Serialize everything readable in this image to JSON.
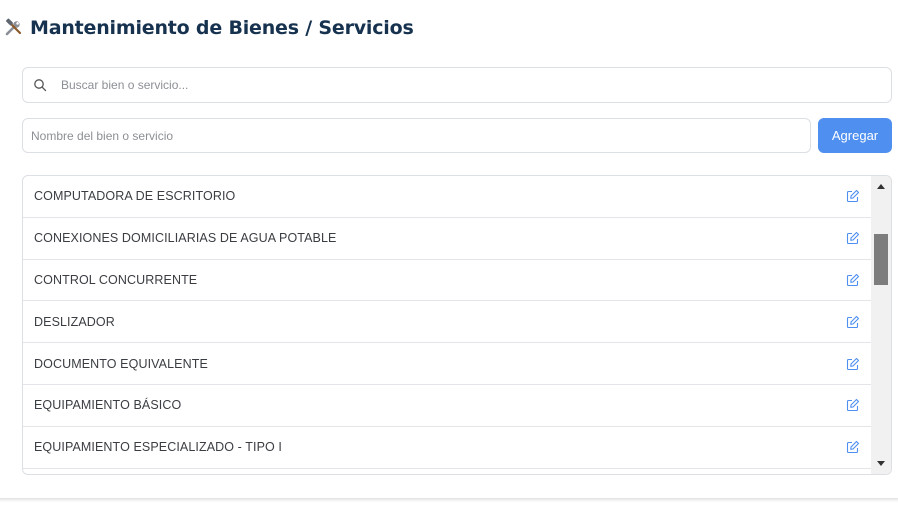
{
  "header": {
    "title": "Mantenimiento de Bienes / Servicios",
    "icon": "hammer-wrench-icon"
  },
  "search": {
    "placeholder": "Buscar bien o servicio...",
    "icon": "search-icon"
  },
  "form": {
    "name_placeholder": "Nombre del bien o servicio",
    "add_label": "Agregar",
    "add_color": "#4e8ff0"
  },
  "list": {
    "items": [
      "COMPUTADORA DE ESCRITORIO",
      "CONEXIONES DOMICILIARIAS DE AGUA POTABLE",
      "CONTROL CONCURRENTE",
      "DESLIZADOR",
      "DOCUMENTO EQUIVALENTE",
      "EQUIPAMIENTO BÁSICO",
      "EQUIPAMIENTO ESPECIALIZADO - TIPO I"
    ],
    "edit_icon": "edit-icon",
    "edit_color": "#4e8ff0"
  },
  "colors": {
    "title": "#16324f",
    "accent": "#4e8ff0"
  }
}
